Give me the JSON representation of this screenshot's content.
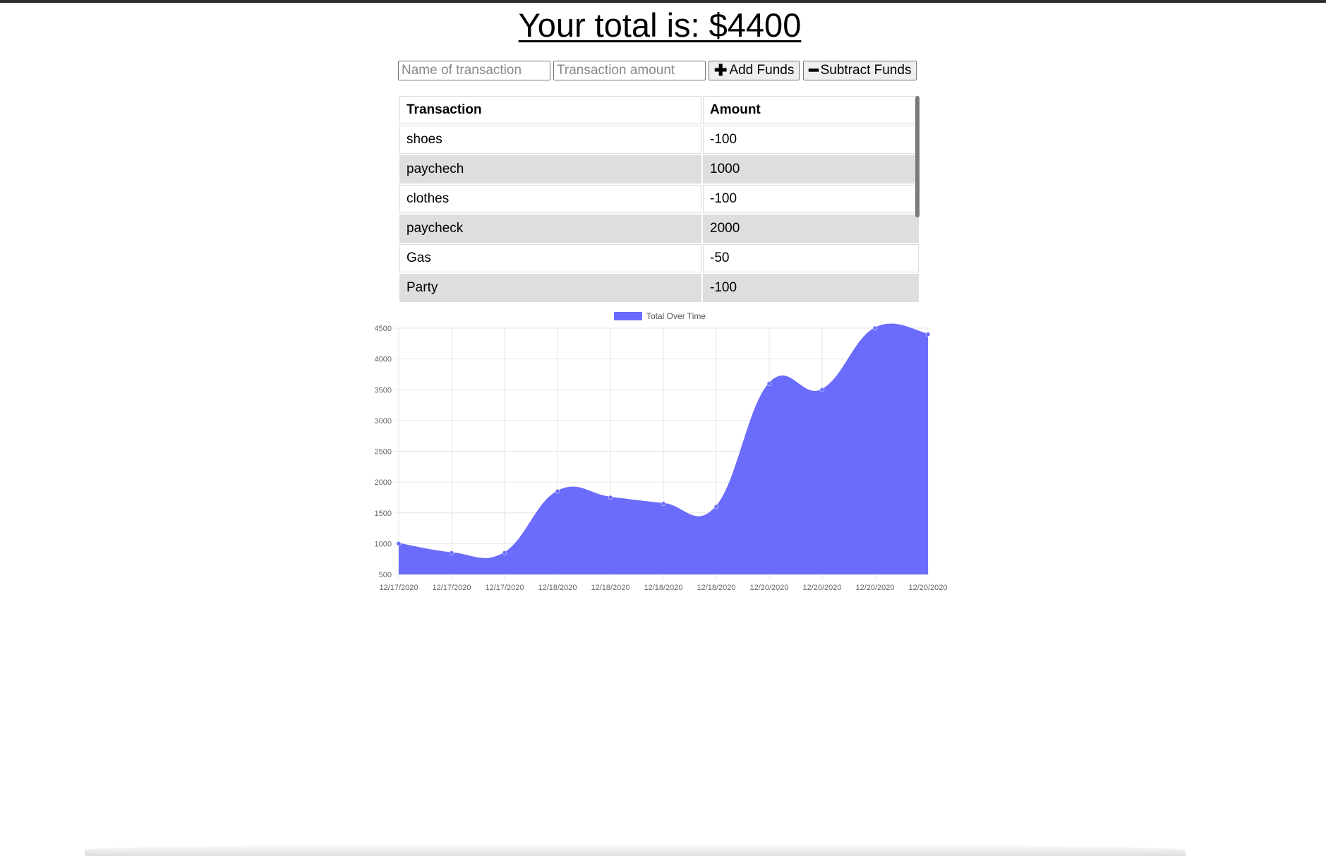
{
  "header": {
    "total_label": "Your total is: $4400"
  },
  "form": {
    "name_placeholder": "Name of transaction",
    "amount_placeholder": "Transaction amount",
    "add_label": "Add Funds",
    "subtract_label": "Subtract Funds"
  },
  "table": {
    "headers": [
      "Transaction",
      "Amount"
    ],
    "rows": [
      {
        "name": "shoes",
        "amount": "-100"
      },
      {
        "name": "paychech",
        "amount": "1000"
      },
      {
        "name": "clothes",
        "amount": "-100"
      },
      {
        "name": "paycheck",
        "amount": "2000"
      },
      {
        "name": "Gas",
        "amount": "-50"
      },
      {
        "name": "Party",
        "amount": "-100"
      }
    ]
  },
  "colors": {
    "series_fill": "#6b6cfb",
    "grid": "#e6e6e6",
    "tick_text": "#666666"
  },
  "chart_data": {
    "type": "area",
    "legend_position": "top",
    "grid": true,
    "x": [
      "12/17/2020",
      "12/17/2020",
      "12/17/2020",
      "12/18/2020",
      "12/18/2020",
      "12/18/2020",
      "12/18/2020",
      "12/20/2020",
      "12/20/2020",
      "12/20/2020",
      "12/20/2020"
    ],
    "series": [
      {
        "name": "Total Over Time",
        "values": [
          1000,
          850,
          850,
          1850,
          1750,
          1650,
          1600,
          3600,
          3500,
          4500,
          4400
        ]
      }
    ],
    "ylim": [
      500,
      4500
    ],
    "yticks": [
      500,
      1000,
      1500,
      2000,
      2500,
      3000,
      3500,
      4000,
      4500
    ]
  }
}
